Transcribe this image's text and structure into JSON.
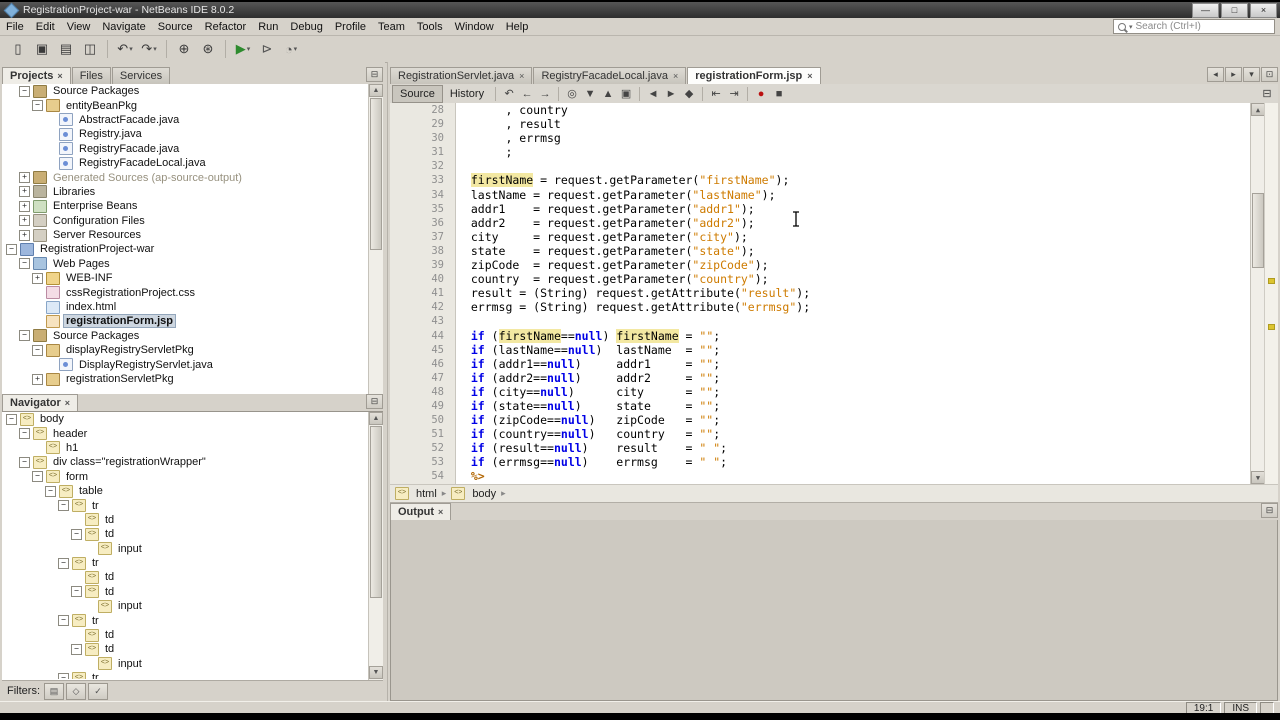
{
  "window": {
    "title": "RegistrationProject-war - NetBeans IDE 8.0.2",
    "controls": [
      {
        "name": "minimize-button",
        "glyph": "—"
      },
      {
        "name": "maximize-button",
        "glyph": "□"
      },
      {
        "name": "close-button",
        "glyph": "×"
      }
    ]
  },
  "menubar": {
    "items": [
      "File",
      "Edit",
      "View",
      "Navigate",
      "Source",
      "Refactor",
      "Run",
      "Debug",
      "Profile",
      "Team",
      "Tools",
      "Window",
      "Help"
    ],
    "search": {
      "label": "Search (Ctrl+I)"
    }
  },
  "main_toolbar": [
    {
      "name": "new-file-icon",
      "glyph": "▯"
    },
    {
      "name": "new-project-icon",
      "glyph": "▣"
    },
    {
      "name": "open-project-icon",
      "glyph": "▤"
    },
    {
      "name": "save-all-icon",
      "glyph": "◫"
    },
    {
      "sep": true
    },
    {
      "name": "undo-icon",
      "glyph": "↶",
      "dropdown": true
    },
    {
      "name": "redo-icon",
      "glyph": "↷",
      "dropdown": true
    },
    {
      "sep": true
    },
    {
      "name": "build-project-icon",
      "glyph": "⊕"
    },
    {
      "name": "clean-build-project-icon",
      "glyph": "⊛"
    },
    {
      "sep": true
    },
    {
      "name": "run-project-icon",
      "glyph": "▶",
      "color": "#2e8b2e",
      "dropdown": true
    },
    {
      "name": "debug-project-icon",
      "glyph": "⊳",
      "color": "#555555"
    },
    {
      "name": "profile-project-icon",
      "glyph": "◔",
      "color": "#555555",
      "dropdown": true
    }
  ],
  "projects_panel": {
    "tabs": [
      {
        "label": "Projects",
        "active": true,
        "closable": true
      },
      {
        "label": "Files",
        "active": false,
        "closable": false
      },
      {
        "label": "Services",
        "active": false,
        "closable": false
      }
    ],
    "tree": [
      {
        "l": "Source Packages",
        "lv": 1,
        "e": "minus",
        "i": "source-root"
      },
      {
        "l": "entityBeanPkg",
        "lv": 2,
        "e": "minus",
        "i": "package"
      },
      {
        "l": "AbstractFacade.java",
        "lv": 3,
        "e": "none",
        "i": "java-file"
      },
      {
        "l": "Registry.java",
        "lv": 3,
        "e": "none",
        "i": "java-file"
      },
      {
        "l": "RegistryFacade.java",
        "lv": 3,
        "e": "none",
        "i": "java-file"
      },
      {
        "l": "RegistryFacadeLocal.java",
        "lv": 3,
        "e": "none",
        "i": "java-file"
      },
      {
        "l": "Generated Sources (ap-source-output)",
        "lv": 1,
        "e": "plus",
        "i": "source-root",
        "muted": true
      },
      {
        "l": "Libraries",
        "lv": 1,
        "e": "plus",
        "i": "libraries"
      },
      {
        "l": "Enterprise Beans",
        "lv": 1,
        "e": "plus",
        "i": "beans"
      },
      {
        "l": "Configuration Files",
        "lv": 1,
        "e": "plus",
        "i": "config"
      },
      {
        "l": "Server Resources",
        "lv": 1,
        "e": "plus",
        "i": "config"
      },
      {
        "l": "RegistrationProject-war",
        "lv": 0,
        "e": "minus",
        "i": "project"
      },
      {
        "l": "Web Pages",
        "lv": 1,
        "e": "minus",
        "i": "web-pages"
      },
      {
        "l": "WEB-INF",
        "lv": 2,
        "e": "plus",
        "i": "folder"
      },
      {
        "l": "cssRegistrationProject.css",
        "lv": 2,
        "e": "none",
        "i": "css-file"
      },
      {
        "l": "index.html",
        "lv": 2,
        "e": "none",
        "i": "html-file"
      },
      {
        "l": "registrationForm.jsp",
        "lv": 2,
        "e": "none",
        "i": "jsp-file",
        "sel": true
      },
      {
        "l": "Source Packages",
        "lv": 1,
        "e": "minus",
        "i": "source-root"
      },
      {
        "l": "displayRegistryServletPkg",
        "lv": 2,
        "e": "minus",
        "i": "package"
      },
      {
        "l": "DisplayRegistryServlet.java",
        "lv": 3,
        "e": "none",
        "i": "java-file"
      },
      {
        "l": "registrationServletPkg",
        "lv": 2,
        "e": "plus",
        "i": "package"
      }
    ]
  },
  "navigator_panel": {
    "title": "Navigator",
    "tree": [
      {
        "l": "body",
        "lv": 0,
        "e": "minus",
        "i": "tag"
      },
      {
        "l": "header",
        "lv": 1,
        "e": "minus",
        "i": "tag"
      },
      {
        "l": "h1",
        "lv": 2,
        "e": "none",
        "i": "tag"
      },
      {
        "l": "div class=\"registrationWrapper\"",
        "lv": 1,
        "e": "minus",
        "i": "tag"
      },
      {
        "l": "form",
        "lv": 2,
        "e": "minus",
        "i": "tag"
      },
      {
        "l": "table",
        "lv": 3,
        "e": "minus",
        "i": "tag"
      },
      {
        "l": "tr",
        "lv": 4,
        "e": "minus",
        "i": "tag"
      },
      {
        "l": "td",
        "lv": 5,
        "e": "none",
        "i": "tag"
      },
      {
        "l": "td",
        "lv": 5,
        "e": "minus",
        "i": "tag"
      },
      {
        "l": "input",
        "lv": 6,
        "e": "none",
        "i": "tag"
      },
      {
        "l": "tr",
        "lv": 4,
        "e": "minus",
        "i": "tag"
      },
      {
        "l": "td",
        "lv": 5,
        "e": "none",
        "i": "tag"
      },
      {
        "l": "td",
        "lv": 5,
        "e": "minus",
        "i": "tag"
      },
      {
        "l": "input",
        "lv": 6,
        "e": "none",
        "i": "tag"
      },
      {
        "l": "tr",
        "lv": 4,
        "e": "minus",
        "i": "tag"
      },
      {
        "l": "td",
        "lv": 5,
        "e": "none",
        "i": "tag"
      },
      {
        "l": "td",
        "lv": 5,
        "e": "minus",
        "i": "tag"
      },
      {
        "l": "input",
        "lv": 6,
        "e": "none",
        "i": "tag"
      },
      {
        "l": "tr",
        "lv": 4,
        "e": "minus",
        "i": "tag"
      }
    ],
    "filters": {
      "label": "Filters:",
      "buttons": [
        {
          "name": "filter-toggle-1-icon",
          "glyph": "▤"
        },
        {
          "name": "filter-toggle-2-icon",
          "glyph": "◇"
        },
        {
          "name": "filter-toggle-3-icon",
          "glyph": "✓"
        }
      ]
    }
  },
  "editor": {
    "tabs": [
      {
        "label": "RegistrationServlet.java",
        "active": false
      },
      {
        "label": "RegistryFacadeLocal.java",
        "active": false
      },
      {
        "label": "registrationForm.jsp",
        "active": true
      }
    ],
    "tab_controls": [
      {
        "name": "scroll-tabs-left-icon",
        "glyph": "◂"
      },
      {
        "name": "scroll-tabs-right-icon",
        "glyph": "▸"
      },
      {
        "name": "tab-list-icon",
        "glyph": "▾"
      },
      {
        "name": "maximize-editor-icon",
        "glyph": "⊡"
      }
    ],
    "toolbar": {
      "source_label": "Source",
      "history_label": "History",
      "icons": [
        {
          "name": "last-edit-position-icon",
          "glyph": "↶"
        },
        {
          "name": "back-icon",
          "glyph": "←"
        },
        {
          "name": "forward-icon",
          "glyph": "→"
        },
        {
          "sep": true
        },
        {
          "name": "find-selection-icon",
          "glyph": "◎"
        },
        {
          "name": "find-next-occurrence-icon",
          "glyph": "▼"
        },
        {
          "name": "find-previous-occurrence-icon",
          "glyph": "▲"
        },
        {
          "name": "toggle-highlight-search-icon",
          "glyph": "▣"
        },
        {
          "sep": true
        },
        {
          "name": "previous-bookmark-icon",
          "glyph": "◄"
        },
        {
          "name": "next-bookmark-icon",
          "glyph": "►"
        },
        {
          "name": "toggle-bookmark-icon",
          "glyph": "◆"
        },
        {
          "sep": true
        },
        {
          "name": "shift-line-left-icon",
          "glyph": "⇤"
        },
        {
          "name": "shift-line-right-icon",
          "glyph": "⇥"
        },
        {
          "sep": true
        },
        {
          "name": "start-macro-recording-icon",
          "glyph": "●",
          "color": "#bb1111"
        },
        {
          "name": "stop-macro-recording-icon",
          "glyph": "■"
        }
      ],
      "right_icon": {
        "name": "toggle-editor-toolbar-icon",
        "glyph": "⊟"
      }
    },
    "code_lines": [
      {
        "n": "28",
        "seg": [
          [
            "p",
            "       , country"
          ]
        ]
      },
      {
        "n": "29",
        "seg": [
          [
            "p",
            "       , result"
          ]
        ]
      },
      {
        "n": "30",
        "seg": [
          [
            "p",
            "       , errmsg"
          ]
        ]
      },
      {
        "n": "31",
        "seg": [
          [
            "p",
            "       ;"
          ]
        ]
      },
      {
        "n": "32",
        "seg": []
      },
      {
        "n": "33",
        "seg": [
          [
            "p",
            "  "
          ],
          [
            "h",
            "firstName"
          ],
          [
            "p",
            " = request.getParameter("
          ],
          [
            "s",
            "\"firstName\""
          ],
          [
            "p",
            ");"
          ]
        ]
      },
      {
        "n": "34",
        "seg": [
          [
            "p",
            "  lastName = request.getParameter("
          ],
          [
            "s",
            "\"lastName\""
          ],
          [
            "p",
            ");"
          ]
        ]
      },
      {
        "n": "35",
        "seg": [
          [
            "p",
            "  addr1    = request.getParameter("
          ],
          [
            "s",
            "\"addr1\""
          ],
          [
            "p",
            ");"
          ]
        ]
      },
      {
        "n": "36",
        "seg": [
          [
            "p",
            "  addr2    = request.getParameter("
          ],
          [
            "s",
            "\"addr2\""
          ],
          [
            "p",
            ");"
          ]
        ]
      },
      {
        "n": "37",
        "seg": [
          [
            "p",
            "  city     = request.getParameter("
          ],
          [
            "s",
            "\"city\""
          ],
          [
            "p",
            ");"
          ]
        ]
      },
      {
        "n": "38",
        "seg": [
          [
            "p",
            "  state    = request.getParameter("
          ],
          [
            "s",
            "\"state\""
          ],
          [
            "p",
            ");"
          ]
        ]
      },
      {
        "n": "39",
        "seg": [
          [
            "p",
            "  zipCode  = request.getParameter("
          ],
          [
            "s",
            "\"zipCode\""
          ],
          [
            "p",
            ");"
          ]
        ]
      },
      {
        "n": "40",
        "seg": [
          [
            "p",
            "  country  = request.getParameter("
          ],
          [
            "s",
            "\"country\""
          ],
          [
            "p",
            ");"
          ]
        ]
      },
      {
        "n": "41",
        "seg": [
          [
            "p",
            "  result = (String) request.getAttribute("
          ],
          [
            "s",
            "\"result\""
          ],
          [
            "p",
            ");"
          ]
        ]
      },
      {
        "n": "42",
        "seg": [
          [
            "p",
            "  errmsg = (String) request.getAttribute("
          ],
          [
            "s",
            "\"errmsg\""
          ],
          [
            "p",
            ");"
          ]
        ]
      },
      {
        "n": "43",
        "seg": []
      },
      {
        "n": "44",
        "seg": [
          [
            "p",
            "  "
          ],
          [
            "k",
            "if"
          ],
          [
            "p",
            " ("
          ],
          [
            "h",
            "firstName"
          ],
          [
            "p",
            "=="
          ],
          [
            "k",
            "null"
          ],
          [
            "p",
            ") "
          ],
          [
            "h",
            "firstName"
          ],
          [
            "p",
            " = "
          ],
          [
            "s",
            "\"\""
          ],
          [
            "p",
            ";"
          ]
        ]
      },
      {
        "n": "45",
        "seg": [
          [
            "p",
            "  "
          ],
          [
            "k",
            "if"
          ],
          [
            "p",
            " (lastName=="
          ],
          [
            "k",
            "null"
          ],
          [
            "p",
            ")  lastName  = "
          ],
          [
            "s",
            "\"\""
          ],
          [
            "p",
            ";"
          ]
        ]
      },
      {
        "n": "46",
        "seg": [
          [
            "p",
            "  "
          ],
          [
            "k",
            "if"
          ],
          [
            "p",
            " (addr1=="
          ],
          [
            "k",
            "null"
          ],
          [
            "p",
            ")     addr1     = "
          ],
          [
            "s",
            "\"\""
          ],
          [
            "p",
            ";"
          ]
        ]
      },
      {
        "n": "47",
        "seg": [
          [
            "p",
            "  "
          ],
          [
            "k",
            "if"
          ],
          [
            "p",
            " (addr2=="
          ],
          [
            "k",
            "null"
          ],
          [
            "p",
            ")     addr2     = "
          ],
          [
            "s",
            "\"\""
          ],
          [
            "p",
            ";"
          ]
        ]
      },
      {
        "n": "48",
        "seg": [
          [
            "p",
            "  "
          ],
          [
            "k",
            "if"
          ],
          [
            "p",
            " (city=="
          ],
          [
            "k",
            "null"
          ],
          [
            "p",
            ")      city      = "
          ],
          [
            "s",
            "\"\""
          ],
          [
            "p",
            ";"
          ]
        ]
      },
      {
        "n": "49",
        "seg": [
          [
            "p",
            "  "
          ],
          [
            "k",
            "if"
          ],
          [
            "p",
            " (state=="
          ],
          [
            "k",
            "null"
          ],
          [
            "p",
            ")     state     = "
          ],
          [
            "s",
            "\"\""
          ],
          [
            "p",
            ";"
          ]
        ]
      },
      {
        "n": "50",
        "seg": [
          [
            "p",
            "  "
          ],
          [
            "k",
            "if"
          ],
          [
            "p",
            " (zipCode=="
          ],
          [
            "k",
            "null"
          ],
          [
            "p",
            ")   zipCode   = "
          ],
          [
            "s",
            "\"\""
          ],
          [
            "p",
            ";"
          ]
        ]
      },
      {
        "n": "51",
        "seg": [
          [
            "p",
            "  "
          ],
          [
            "k",
            "if"
          ],
          [
            "p",
            " (country=="
          ],
          [
            "k",
            "null"
          ],
          [
            "p",
            ")   country   = "
          ],
          [
            "s",
            "\"\""
          ],
          [
            "p",
            ";"
          ]
        ]
      },
      {
        "n": "52",
        "seg": [
          [
            "p",
            "  "
          ],
          [
            "k",
            "if"
          ],
          [
            "p",
            " (result=="
          ],
          [
            "k",
            "null"
          ],
          [
            "p",
            ")    result    = "
          ],
          [
            "s",
            "\" \""
          ],
          [
            "p",
            ";"
          ]
        ]
      },
      {
        "n": "53",
        "seg": [
          [
            "p",
            "  "
          ],
          [
            "k",
            "if"
          ],
          [
            "p",
            " (errmsg=="
          ],
          [
            "k",
            "null"
          ],
          [
            "p",
            ")    errmsg    = "
          ],
          [
            "s",
            "\" \""
          ],
          [
            "p",
            ";"
          ]
        ]
      },
      {
        "n": "54",
        "seg": [
          [
            "d",
            "  %>"
          ]
        ]
      }
    ],
    "error_stripe_marks": [
      0.46,
      0.58
    ],
    "breadcrumb": {
      "items": [
        "html",
        "body"
      ]
    }
  },
  "output_panel": {
    "title": "Output",
    "right_icons": [
      {
        "name": "minimize-window-icon",
        "glyph": "⊟"
      }
    ]
  },
  "statusbar": {
    "caret_position": "19:1",
    "insert_mode": "INS"
  }
}
